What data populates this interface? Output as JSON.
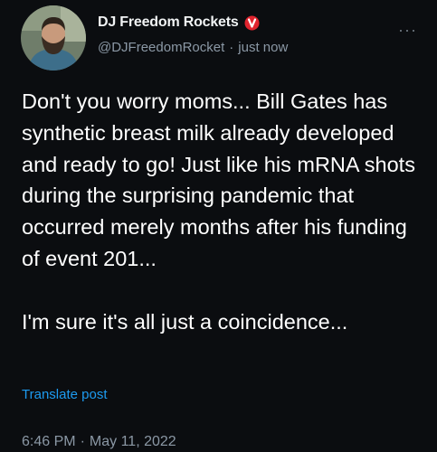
{
  "post": {
    "author": {
      "display_name": "DJ Freedom Rockets",
      "badge_icon": "verified-badge-icon",
      "handle": "@DJFreedomRocket",
      "separator": "·",
      "relative_time": "just now",
      "avatar_icon": "profile-photo"
    },
    "more_options": "···",
    "text": "Don't you worry moms... Bill Gates has synthetic breast milk already developed and ready to go! Just like his mRNA shots during the surprising pandemic that occurred merely months after his funding of event 201...\n\nI'm sure it's all just a coincidence...",
    "translate_label": "Translate post",
    "timestamp": {
      "time": "6:46 PM",
      "separator": "·",
      "date": "May 11, 2022"
    },
    "colors": {
      "background": "#0b0d10",
      "link": "#1d9bf0",
      "secondary_text": "#8b98a5",
      "badge": "#e0242e"
    }
  }
}
